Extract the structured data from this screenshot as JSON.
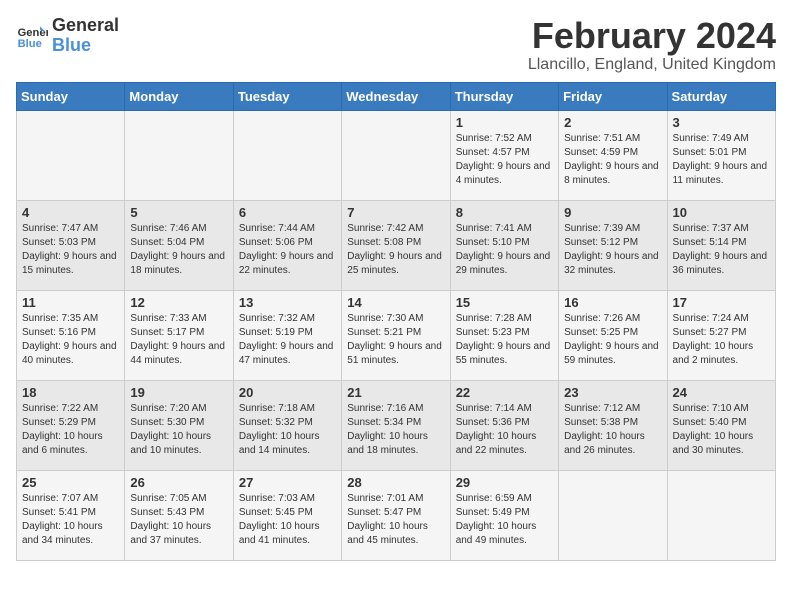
{
  "logo": {
    "line1": "General",
    "line2": "Blue"
  },
  "title": "February 2024",
  "location": "Llancillo, England, United Kingdom",
  "days_of_week": [
    "Sunday",
    "Monday",
    "Tuesday",
    "Wednesday",
    "Thursday",
    "Friday",
    "Saturday"
  ],
  "weeks": [
    [
      {
        "day": "",
        "info": ""
      },
      {
        "day": "",
        "info": ""
      },
      {
        "day": "",
        "info": ""
      },
      {
        "day": "",
        "info": ""
      },
      {
        "day": "1",
        "info": "Sunrise: 7:52 AM\nSunset: 4:57 PM\nDaylight: 9 hours\nand 4 minutes."
      },
      {
        "day": "2",
        "info": "Sunrise: 7:51 AM\nSunset: 4:59 PM\nDaylight: 9 hours\nand 8 minutes."
      },
      {
        "day": "3",
        "info": "Sunrise: 7:49 AM\nSunset: 5:01 PM\nDaylight: 9 hours\nand 11 minutes."
      }
    ],
    [
      {
        "day": "4",
        "info": "Sunrise: 7:47 AM\nSunset: 5:03 PM\nDaylight: 9 hours\nand 15 minutes."
      },
      {
        "day": "5",
        "info": "Sunrise: 7:46 AM\nSunset: 5:04 PM\nDaylight: 9 hours\nand 18 minutes."
      },
      {
        "day": "6",
        "info": "Sunrise: 7:44 AM\nSunset: 5:06 PM\nDaylight: 9 hours\nand 22 minutes."
      },
      {
        "day": "7",
        "info": "Sunrise: 7:42 AM\nSunset: 5:08 PM\nDaylight: 9 hours\nand 25 minutes."
      },
      {
        "day": "8",
        "info": "Sunrise: 7:41 AM\nSunset: 5:10 PM\nDaylight: 9 hours\nand 29 minutes."
      },
      {
        "day": "9",
        "info": "Sunrise: 7:39 AM\nSunset: 5:12 PM\nDaylight: 9 hours\nand 32 minutes."
      },
      {
        "day": "10",
        "info": "Sunrise: 7:37 AM\nSunset: 5:14 PM\nDaylight: 9 hours\nand 36 minutes."
      }
    ],
    [
      {
        "day": "11",
        "info": "Sunrise: 7:35 AM\nSunset: 5:16 PM\nDaylight: 9 hours\nand 40 minutes."
      },
      {
        "day": "12",
        "info": "Sunrise: 7:33 AM\nSunset: 5:17 PM\nDaylight: 9 hours\nand 44 minutes."
      },
      {
        "day": "13",
        "info": "Sunrise: 7:32 AM\nSunset: 5:19 PM\nDaylight: 9 hours\nand 47 minutes."
      },
      {
        "day": "14",
        "info": "Sunrise: 7:30 AM\nSunset: 5:21 PM\nDaylight: 9 hours\nand 51 minutes."
      },
      {
        "day": "15",
        "info": "Sunrise: 7:28 AM\nSunset: 5:23 PM\nDaylight: 9 hours\nand 55 minutes."
      },
      {
        "day": "16",
        "info": "Sunrise: 7:26 AM\nSunset: 5:25 PM\nDaylight: 9 hours\nand 59 minutes."
      },
      {
        "day": "17",
        "info": "Sunrise: 7:24 AM\nSunset: 5:27 PM\nDaylight: 10 hours\nand 2 minutes."
      }
    ],
    [
      {
        "day": "18",
        "info": "Sunrise: 7:22 AM\nSunset: 5:29 PM\nDaylight: 10 hours\nand 6 minutes."
      },
      {
        "day": "19",
        "info": "Sunrise: 7:20 AM\nSunset: 5:30 PM\nDaylight: 10 hours\nand 10 minutes."
      },
      {
        "day": "20",
        "info": "Sunrise: 7:18 AM\nSunset: 5:32 PM\nDaylight: 10 hours\nand 14 minutes."
      },
      {
        "day": "21",
        "info": "Sunrise: 7:16 AM\nSunset: 5:34 PM\nDaylight: 10 hours\nand 18 minutes."
      },
      {
        "day": "22",
        "info": "Sunrise: 7:14 AM\nSunset: 5:36 PM\nDaylight: 10 hours\nand 22 minutes."
      },
      {
        "day": "23",
        "info": "Sunrise: 7:12 AM\nSunset: 5:38 PM\nDaylight: 10 hours\nand 26 minutes."
      },
      {
        "day": "24",
        "info": "Sunrise: 7:10 AM\nSunset: 5:40 PM\nDaylight: 10 hours\nand 30 minutes."
      }
    ],
    [
      {
        "day": "25",
        "info": "Sunrise: 7:07 AM\nSunset: 5:41 PM\nDaylight: 10 hours\nand 34 minutes."
      },
      {
        "day": "26",
        "info": "Sunrise: 7:05 AM\nSunset: 5:43 PM\nDaylight: 10 hours\nand 37 minutes."
      },
      {
        "day": "27",
        "info": "Sunrise: 7:03 AM\nSunset: 5:45 PM\nDaylight: 10 hours\nand 41 minutes."
      },
      {
        "day": "28",
        "info": "Sunrise: 7:01 AM\nSunset: 5:47 PM\nDaylight: 10 hours\nand 45 minutes."
      },
      {
        "day": "29",
        "info": "Sunrise: 6:59 AM\nSunset: 5:49 PM\nDaylight: 10 hours\nand 49 minutes."
      },
      {
        "day": "",
        "info": ""
      },
      {
        "day": "",
        "info": ""
      }
    ]
  ]
}
